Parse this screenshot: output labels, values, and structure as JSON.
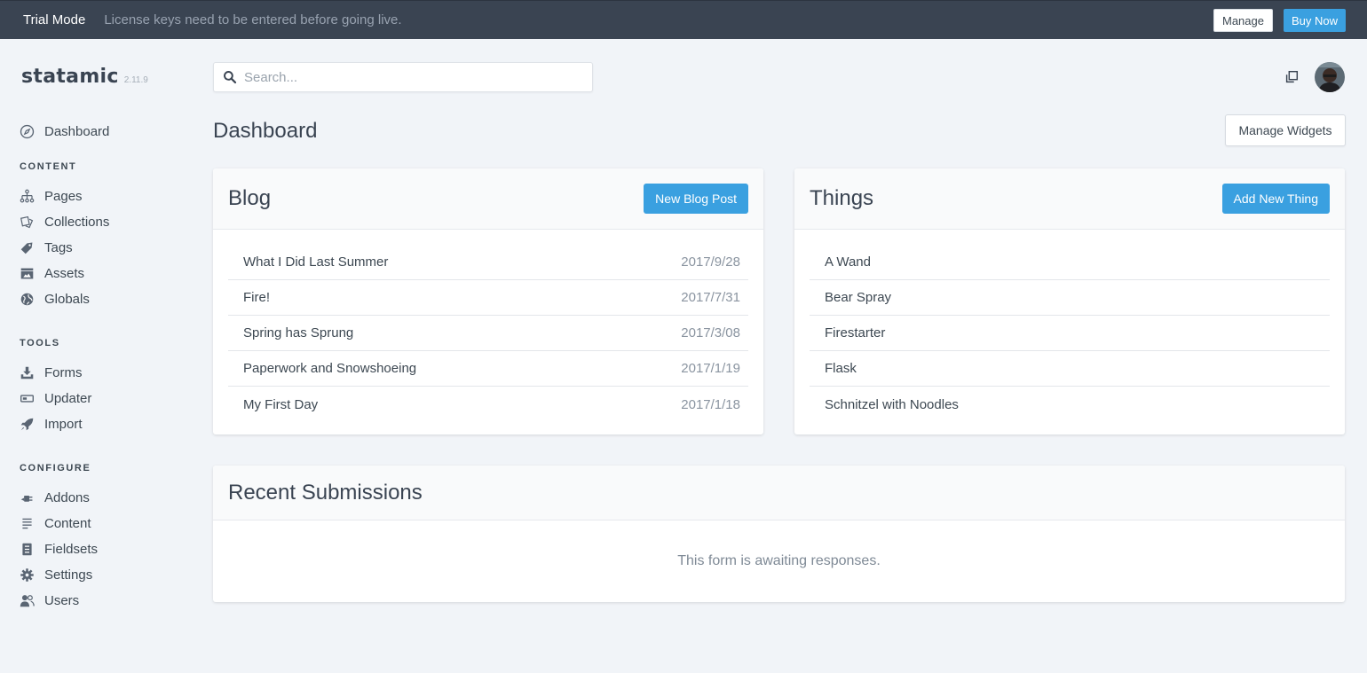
{
  "trial": {
    "title": "Trial Mode",
    "message": "License keys need to be entered before going live.",
    "manage_label": "Manage",
    "buy_label": "Buy Now"
  },
  "brand": {
    "name": "statamic",
    "version": "2.11.9"
  },
  "search": {
    "placeholder": "Search..."
  },
  "nav": {
    "dashboard": "Dashboard",
    "content_heading": "CONTENT",
    "content": [
      {
        "label": "Pages",
        "icon": "sitemap-icon"
      },
      {
        "label": "Collections",
        "icon": "collections-icon"
      },
      {
        "label": "Tags",
        "icon": "tag-icon"
      },
      {
        "label": "Assets",
        "icon": "assets-icon"
      },
      {
        "label": "Globals",
        "icon": "globe-icon"
      }
    ],
    "tools_heading": "TOOLS",
    "tools": [
      {
        "label": "Forms",
        "icon": "download-tray-icon"
      },
      {
        "label": "Updater",
        "icon": "updater-icon"
      },
      {
        "label": "Import",
        "icon": "rocket-icon"
      }
    ],
    "configure_heading": "CONFIGURE",
    "configure": [
      {
        "label": "Addons",
        "icon": "plug-icon"
      },
      {
        "label": "Content",
        "icon": "lines-icon"
      },
      {
        "label": "Fieldsets",
        "icon": "fieldsets-icon"
      },
      {
        "label": "Settings",
        "icon": "gear-icon"
      },
      {
        "label": "Users",
        "icon": "users-icon"
      }
    ]
  },
  "page": {
    "title": "Dashboard",
    "manage_widgets": "Manage Widgets"
  },
  "blog": {
    "title": "Blog",
    "button": "New Blog Post",
    "entries": [
      {
        "title": "What I Did Last Summer",
        "date": "2017/9/28"
      },
      {
        "title": "Fire!",
        "date": "2017/7/31"
      },
      {
        "title": "Spring has Sprung",
        "date": "2017/3/08"
      },
      {
        "title": "Paperwork and Snowshoeing",
        "date": "2017/1/19"
      },
      {
        "title": "My First Day",
        "date": "2017/1/18"
      }
    ]
  },
  "things": {
    "title": "Things",
    "button": "Add New Thing",
    "entries": [
      {
        "title": "A Wand"
      },
      {
        "title": "Bear Spray"
      },
      {
        "title": "Firestarter"
      },
      {
        "title": "Flask"
      },
      {
        "title": "Schnitzel with Noodles"
      }
    ]
  },
  "submissions": {
    "title": "Recent Submissions",
    "empty": "This form is awaiting responses."
  },
  "colors": {
    "topbar": "#3a4452",
    "accent": "#3aa0e0",
    "background": "#f1f4f8"
  }
}
